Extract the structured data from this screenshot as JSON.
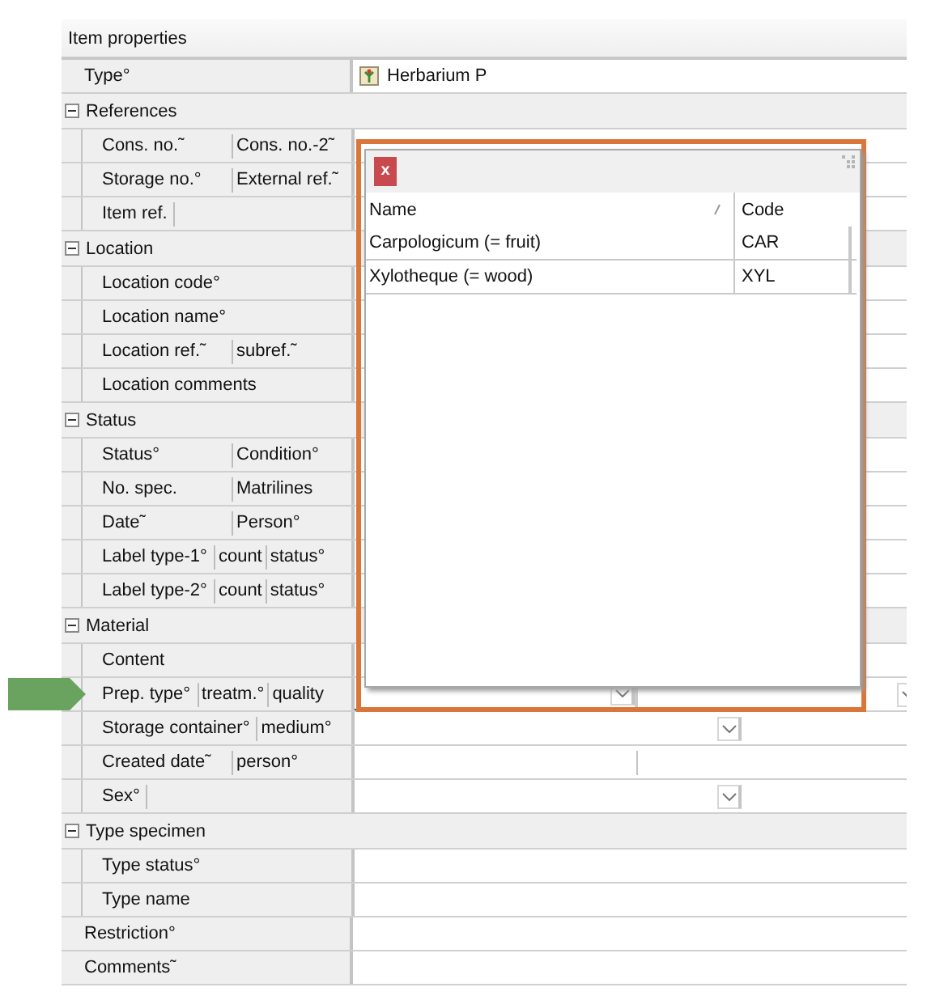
{
  "panel": {
    "title": "Item properties"
  },
  "rows": [
    {
      "kind": "type",
      "labels": [
        "Type°"
      ],
      "value": "Herbarium P"
    },
    {
      "kind": "group",
      "label": "References",
      "expanded": true,
      "children": [
        {
          "kind": "text",
          "labels": [
            "Cons. no.˜",
            "Cons. no.-2˜"
          ],
          "selected": false
        },
        {
          "kind": "text",
          "labels": [
            "Storage no.°",
            "External ref.˜"
          ],
          "selected": false
        },
        {
          "kind": "text",
          "labels": [
            "Item ref."
          ],
          "blank_label_cell": true,
          "selected": false
        }
      ]
    },
    {
      "kind": "group",
      "label": "Location",
      "expanded": true,
      "children": [
        {
          "kind": "text",
          "labels": [
            "Location code°"
          ],
          "selected": false
        },
        {
          "kind": "text",
          "labels": [
            "Location name°"
          ],
          "selected": false
        },
        {
          "kind": "text",
          "labels": [
            "Location ref.˜",
            "subref.˜"
          ],
          "selected": false
        },
        {
          "kind": "text",
          "labels": [
            "Location comments"
          ],
          "selected": false
        }
      ]
    },
    {
      "kind": "group",
      "label": "Status",
      "expanded": true,
      "children": [
        {
          "kind": "text",
          "labels": [
            "Status°",
            "Condition°"
          ],
          "selected": false
        },
        {
          "kind": "text",
          "labels": [
            "No. spec.",
            "Matrilines"
          ],
          "selected": false
        },
        {
          "kind": "text",
          "labels": [
            "Date˜",
            "Person°"
          ],
          "selected": false
        },
        {
          "kind": "text",
          "labels": [
            "Label type-1°",
            "count",
            "status°"
          ],
          "selected": false
        },
        {
          "kind": "text",
          "labels": [
            "Label type-2°",
            "count",
            "status°"
          ],
          "selected": false
        }
      ]
    },
    {
      "kind": "group",
      "label": "Material",
      "expanded": true,
      "children": [
        {
          "kind": "text",
          "labels": [
            "Content"
          ],
          "selected": false
        },
        {
          "kind": "double-dropdown",
          "labels": [
            "Prep. type°",
            "treatm.°",
            "quality"
          ],
          "selected": true
        },
        {
          "kind": "dropdown",
          "labels": [
            "Storage container°",
            "medium°"
          ],
          "selected": false
        },
        {
          "kind": "split",
          "labels": [
            "Created date˜",
            "person°"
          ],
          "selected": false
        },
        {
          "kind": "dropdown",
          "labels": [
            "Sex°"
          ],
          "blank_label_cell": true,
          "selected": false
        }
      ]
    },
    {
      "kind": "group",
      "label": "Type specimen",
      "expanded": true,
      "children": [
        {
          "kind": "text",
          "labels": [
            "Type status°"
          ],
          "selected": false
        },
        {
          "kind": "text",
          "labels": [
            "Type name"
          ],
          "selected": false
        }
      ]
    },
    {
      "kind": "text",
      "labels": [
        "Restriction°"
      ]
    },
    {
      "kind": "text",
      "labels": [
        "Comments˜"
      ]
    }
  ],
  "popup": {
    "close_label": "x",
    "columns": [
      "Name",
      "Code"
    ],
    "rows": [
      {
        "name": "Carpologicum (= fruit)",
        "code": "CAR"
      },
      {
        "name": "Xylotheque (= wood)",
        "code": "XYL"
      }
    ]
  }
}
